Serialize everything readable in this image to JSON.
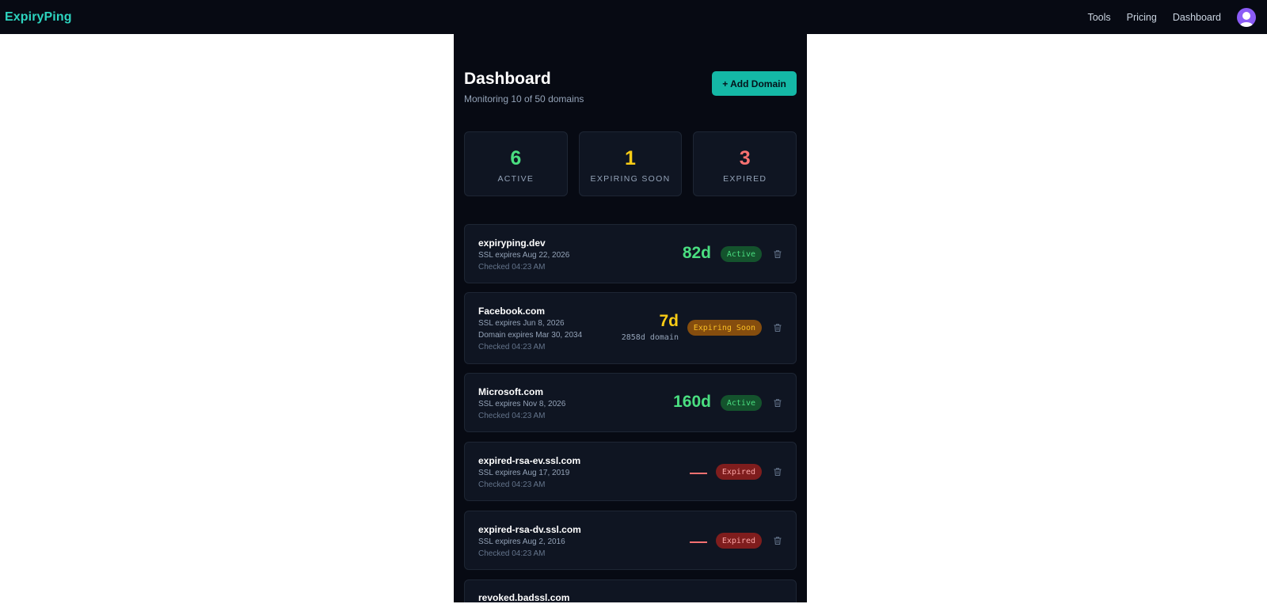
{
  "brand": "ExpiryPing",
  "nav": {
    "tools": "Tools",
    "pricing": "Pricing",
    "dashboard": "Dashboard"
  },
  "page": {
    "title": "Dashboard",
    "subtitle": "Monitoring 10 of 50 domains",
    "add_button": "+ Add Domain"
  },
  "stats": [
    {
      "value": "6",
      "label": "ACTIVE",
      "color": "#4ade80"
    },
    {
      "value": "1",
      "label": "EXPIRING SOON",
      "color": "#facc15"
    },
    {
      "value": "3",
      "label": "EXPIRED",
      "color": "#f87171"
    }
  ],
  "domains": [
    {
      "name": "expiryping.dev",
      "ssl": "SSL expires Aug 22, 2026",
      "checked": "Checked 04:23 AM",
      "days": "82d",
      "status": "Active"
    },
    {
      "name": "Facebook.com",
      "ssl": "SSL expires Jun 8, 2026",
      "domain_exp": "Domain expires Mar 30, 2034",
      "checked": "Checked 04:23 AM",
      "days": "7d",
      "days_sub": "2858d domain",
      "status": "Expiring Soon"
    },
    {
      "name": "Microsoft.com",
      "ssl": "SSL expires Nov 8, 2026",
      "checked": "Checked 04:23 AM",
      "days": "160d",
      "status": "Active"
    },
    {
      "name": "expired-rsa-ev.ssl.com",
      "ssl": "SSL expires Aug 17, 2019",
      "checked": "Checked 04:23 AM",
      "status": "Expired"
    },
    {
      "name": "expired-rsa-dv.ssl.com",
      "ssl": "SSL expires Aug 2, 2016",
      "checked": "Checked 04:23 AM",
      "status": "Expired"
    },
    {
      "name": "revoked.badssl.com"
    }
  ],
  "icons": {
    "avatar": "user-avatar-icon",
    "delete": "trash-icon"
  },
  "colors": {
    "accent": "#14b8a6",
    "active": "#4ade80",
    "soon": "#facc15",
    "expired": "#f87171"
  }
}
